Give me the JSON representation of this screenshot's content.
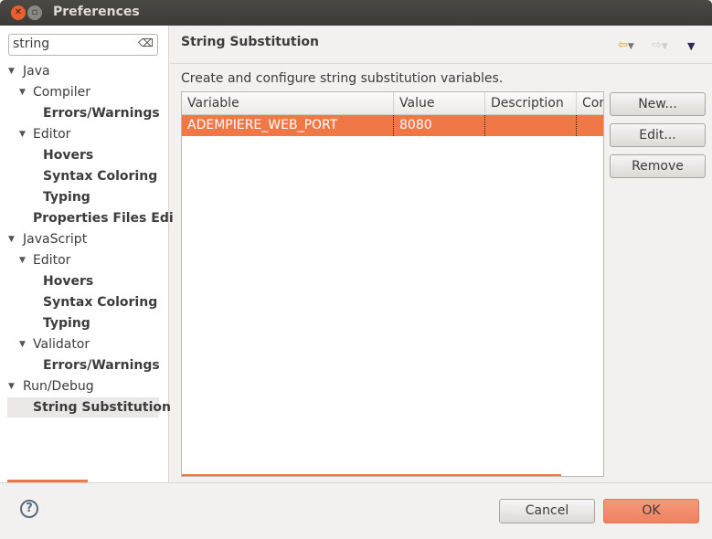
{
  "window": {
    "title": "Preferences"
  },
  "sidebar": {
    "search_value": "string",
    "items": [
      {
        "label": "Java",
        "level": 0,
        "expanded": true,
        "bold": false
      },
      {
        "label": "Compiler",
        "level": 1,
        "expanded": true,
        "bold": false
      },
      {
        "label": "Errors/Warnings",
        "level": 2,
        "bold": true
      },
      {
        "label": "Editor",
        "level": 1,
        "expanded": true,
        "bold": false
      },
      {
        "label": "Hovers",
        "level": 2,
        "bold": true
      },
      {
        "label": "Syntax Coloring",
        "level": 2,
        "bold": true
      },
      {
        "label": "Typing",
        "level": 2,
        "bold": true
      },
      {
        "label": "Properties Files Edi",
        "level": 1,
        "bold": true
      },
      {
        "label": "JavaScript",
        "level": 0,
        "expanded": true,
        "bold": false
      },
      {
        "label": "Editor",
        "level": 1,
        "expanded": true,
        "bold": false
      },
      {
        "label": "Hovers",
        "level": 2,
        "bold": true
      },
      {
        "label": "Syntax Coloring",
        "level": 2,
        "bold": true
      },
      {
        "label": "Typing",
        "level": 2,
        "bold": true
      },
      {
        "label": "Validator",
        "level": 1,
        "expanded": true,
        "bold": false
      },
      {
        "label": "Errors/Warnings",
        "level": 2,
        "bold": true
      },
      {
        "label": "Run/Debug",
        "level": 0,
        "expanded": true,
        "bold": false
      },
      {
        "label": "String Substitution",
        "level": 1,
        "bold": true,
        "selected": true
      }
    ]
  },
  "page": {
    "title": "String Substitution",
    "description": "Create and configure string substitution variables."
  },
  "table": {
    "columns": [
      "Variable",
      "Value",
      "Description",
      "Contributed"
    ],
    "rows": [
      {
        "cells": [
          "ADEMPIERE_WEB_PORT",
          "8080",
          "",
          ""
        ],
        "selected": true
      }
    ]
  },
  "buttons": {
    "new": "New...",
    "edit": "Edit...",
    "remove": "Remove",
    "cancel": "Cancel",
    "ok": "OK"
  },
  "colors": {
    "accent": "#f07746"
  }
}
